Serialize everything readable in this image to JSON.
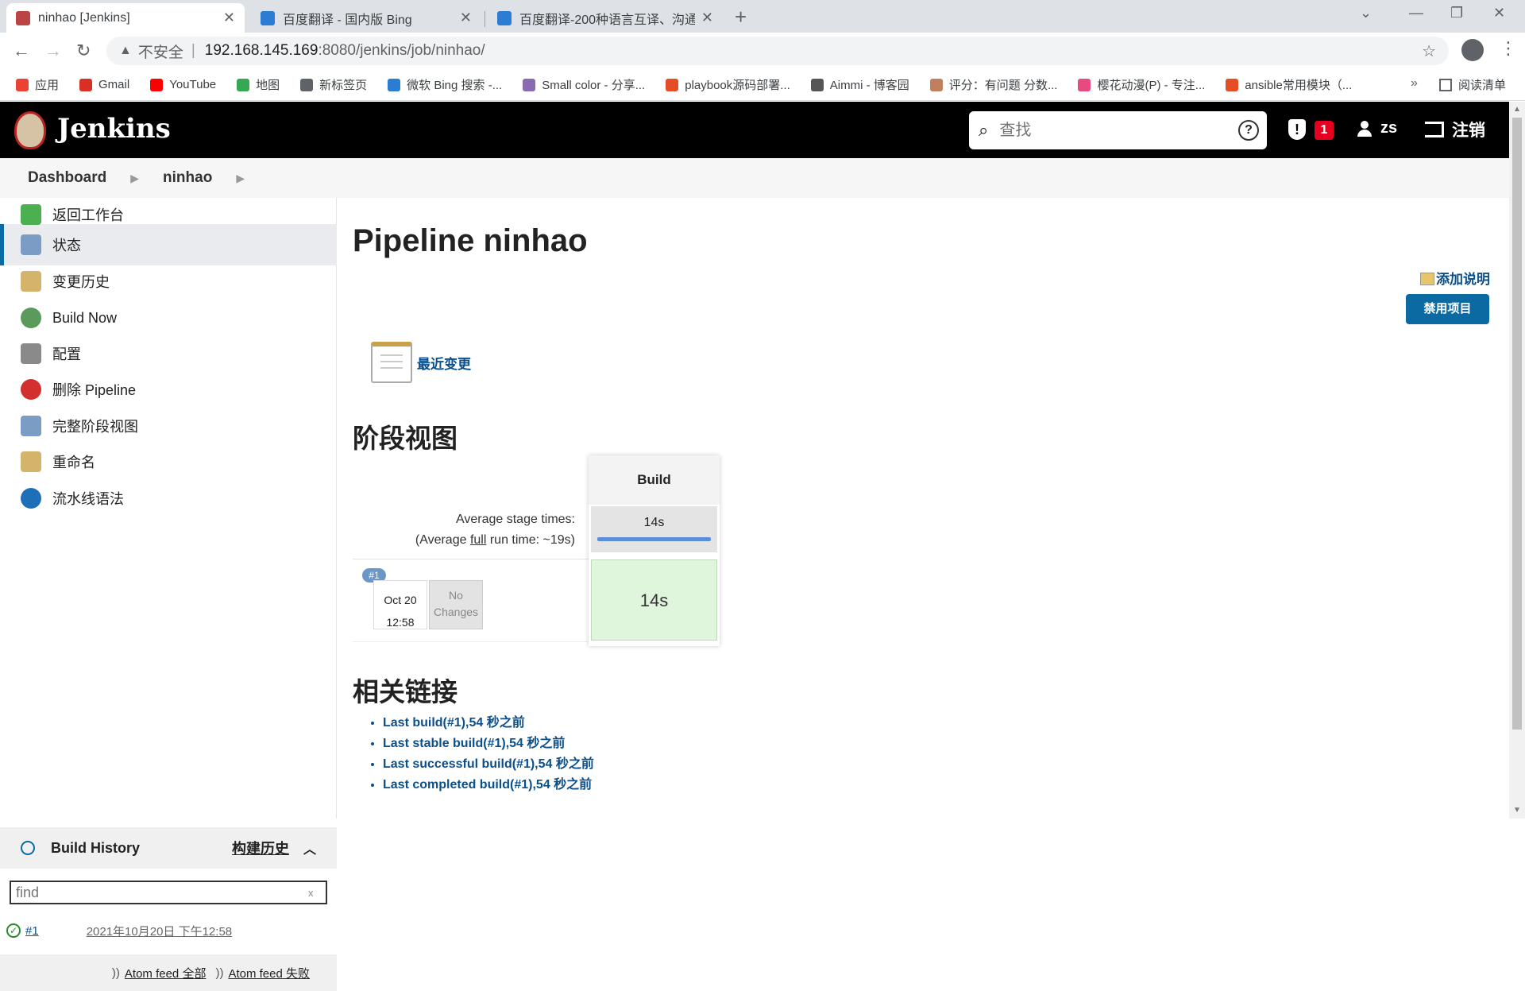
{
  "browser": {
    "tabs": [
      {
        "title": "ninhao [Jenkins]",
        "active": true,
        "favicon_color": "#b44"
      },
      {
        "title": "百度翻译 - 国内版 Bing",
        "active": false,
        "favicon_color": "#2b7cd3"
      },
      {
        "title": "百度翻译-200种语言互译、沟通全",
        "active": false,
        "favicon_color": "#2b7cd3"
      }
    ],
    "url_warning": "不安全",
    "url_host": "192.168.145.169",
    "url_path": ":8080/jenkins/job/ninhao/",
    "bookmarks": [
      {
        "label": "应用",
        "color": "#ea4335"
      },
      {
        "label": "Gmail",
        "color": "#d93025"
      },
      {
        "label": "YouTube",
        "color": "#ff0000"
      },
      {
        "label": "地图",
        "color": "#34a853"
      },
      {
        "label": "新标签页",
        "color": "#5f6368"
      },
      {
        "label": "微软 Bing 搜索 -...",
        "color": "#2b7cd3"
      },
      {
        "label": "Small color - 分享...",
        "color": "#8a6bb1"
      },
      {
        "label": "playbook源码部署...",
        "color": "#e44d26"
      },
      {
        "label": "Aimmi - 博客园",
        "color": "#555555"
      },
      {
        "label": "评分：有问题 分数...",
        "color": "#c08060"
      },
      {
        "label": "樱花动漫(P) - 专注...",
        "color": "#e84a7f"
      },
      {
        "label": "ansible常用模块（...",
        "color": "#e44d26"
      }
    ],
    "bookmarks_more": "»",
    "reading_list": "阅读清单"
  },
  "jenkins": {
    "brand": "Jenkins",
    "search_placeholder": "查找",
    "alert_count": "1",
    "user": "zs",
    "logout": "注销"
  },
  "breadcrumb": [
    "Dashboard",
    "ninhao"
  ],
  "sidebar": {
    "items": [
      {
        "label": "返回工作台",
        "icon": "up-arrow-icon",
        "color": "#4caf50"
      },
      {
        "label": "状态",
        "icon": "magnifier-icon",
        "color": "#7b9cc4"
      },
      {
        "label": "变更历史",
        "icon": "notepad-icon",
        "color": "#d4b46a"
      },
      {
        "label": "Build Now",
        "icon": "clock-icon",
        "color": "#5a9a5a"
      },
      {
        "label": "配置",
        "icon": "gear-icon",
        "color": "#8a8a8a"
      },
      {
        "label": "删除 Pipeline",
        "icon": "no-entry-icon",
        "color": "#d32f2f"
      },
      {
        "label": "完整阶段视图",
        "icon": "magnifier-icon",
        "color": "#7b9cc4"
      },
      {
        "label": "重命名",
        "icon": "notepad-icon",
        "color": "#d4b46a"
      },
      {
        "label": "流水线语法",
        "icon": "help-icon",
        "color": "#1e6fb8"
      }
    ],
    "active_index": 1
  },
  "build_history": {
    "title": "Build History",
    "title_cn": "构建历史",
    "find_placeholder": "find",
    "clear": "x",
    "builds": [
      {
        "number": "#1",
        "date": "2021年10月20日 下午12:58"
      }
    ],
    "feed_all": "Atom feed 全部",
    "feed_fail": "Atom feed 失败"
  },
  "main": {
    "title": "Pipeline ninhao",
    "add_description": "添加说明",
    "disable_button": "禁用项目",
    "recent_changes": "最近变更",
    "stage_view_title": "阶段视图",
    "related_title": "相关链接",
    "related_links": [
      "Last build(#1),54 秒之前",
      "Last stable build(#1),54 秒之前",
      "Last successful build(#1),54 秒之前",
      "Last completed build(#1),54 秒之前"
    ]
  },
  "stage_view": {
    "stage_name": "Build",
    "average_label": "Average stage times:",
    "average_run_prefix": "(Average ",
    "average_run_full": "full",
    "average_run_suffix": " run time: ~19s)",
    "average_stage_time": "14s",
    "run": {
      "badge": "#1",
      "date": "Oct 20",
      "time": "12:58",
      "changes_line1": "No",
      "changes_line2": "Changes",
      "stage_time": "14s"
    }
  }
}
